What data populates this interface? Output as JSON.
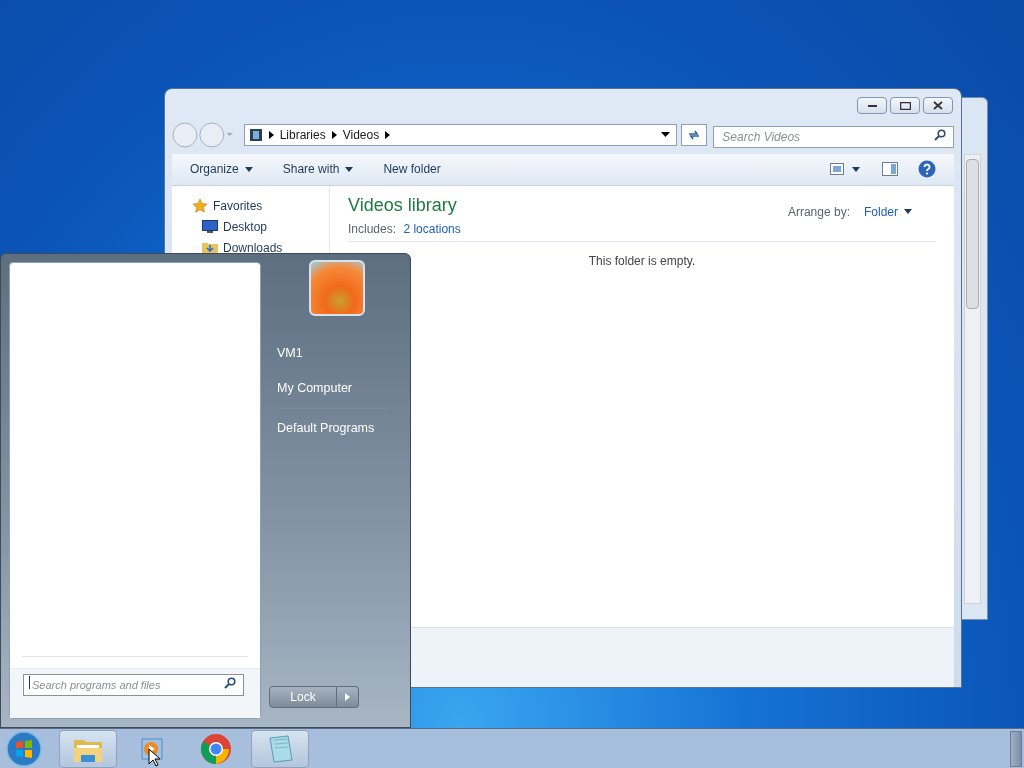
{
  "explorer": {
    "nav_path": [
      "Libraries",
      "Videos"
    ],
    "search_placeholder": "Search Videos",
    "toolbar": [
      {
        "label": "Organize",
        "dropdown": true
      },
      {
        "label": "Share with",
        "dropdown": true
      },
      {
        "label": "New folder",
        "dropdown": false
      }
    ],
    "nav_pane": [
      {
        "label": "Favorites",
        "kind": "group"
      },
      {
        "label": "Desktop",
        "kind": "desktop"
      },
      {
        "label": "Downloads",
        "kind": "downloads"
      }
    ],
    "library": {
      "title": "Videos library",
      "includes_label": "Includes:",
      "includes_link": "2 locations",
      "arrange_label": "Arrange by:",
      "arrange_value": "Folder"
    },
    "empty_message": "This folder is empty."
  },
  "start_menu": {
    "search_placeholder": "Search programs and files",
    "items": [
      {
        "kind": "item",
        "label": "VM1"
      },
      {
        "kind": "item",
        "label": "My Computer"
      },
      {
        "kind": "divider"
      },
      {
        "kind": "item",
        "label": "Default Programs"
      }
    ],
    "shutdown_button": "Lock"
  },
  "taskbar": {
    "items": [
      {
        "kind": "explorer",
        "running": true
      },
      {
        "kind": "media",
        "running": false
      },
      {
        "kind": "chrome",
        "running": false
      },
      {
        "kind": "notepad",
        "running": true
      }
    ]
  }
}
